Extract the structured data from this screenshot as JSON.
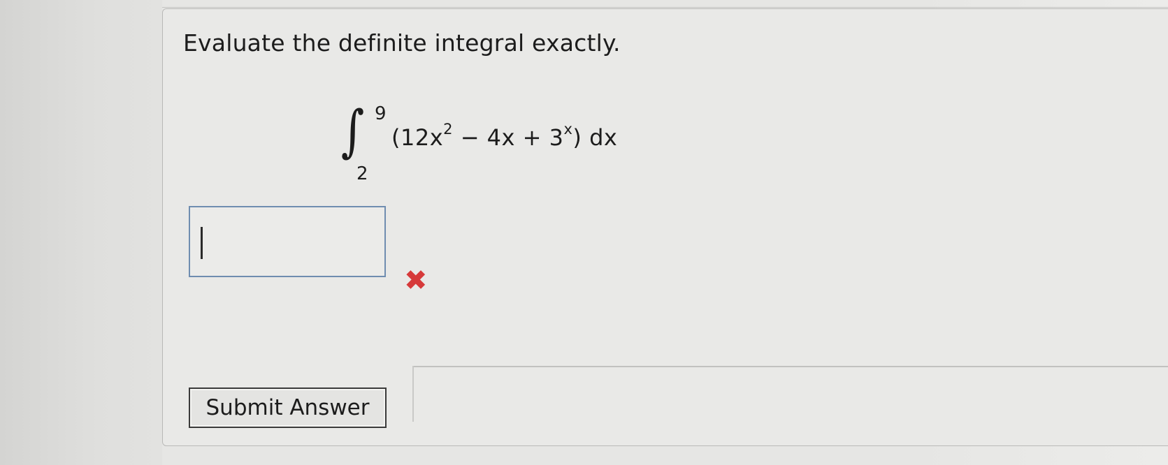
{
  "question": {
    "prompt": "Evaluate the definite integral exactly.",
    "integral": {
      "sign": "∫",
      "upper_limit": "9",
      "lower_limit": "2",
      "integrand_part1": "(12x",
      "exp1": "2",
      "integrand_part2": " − 4x + 3",
      "exp2": "x",
      "integrand_part3": ") dx"
    }
  },
  "answer": {
    "value": "",
    "status_icon": "x-mark-icon",
    "status_symbol": "✖",
    "status_color": "#d63a3a"
  },
  "actions": {
    "submit_label": "Submit Answer"
  }
}
